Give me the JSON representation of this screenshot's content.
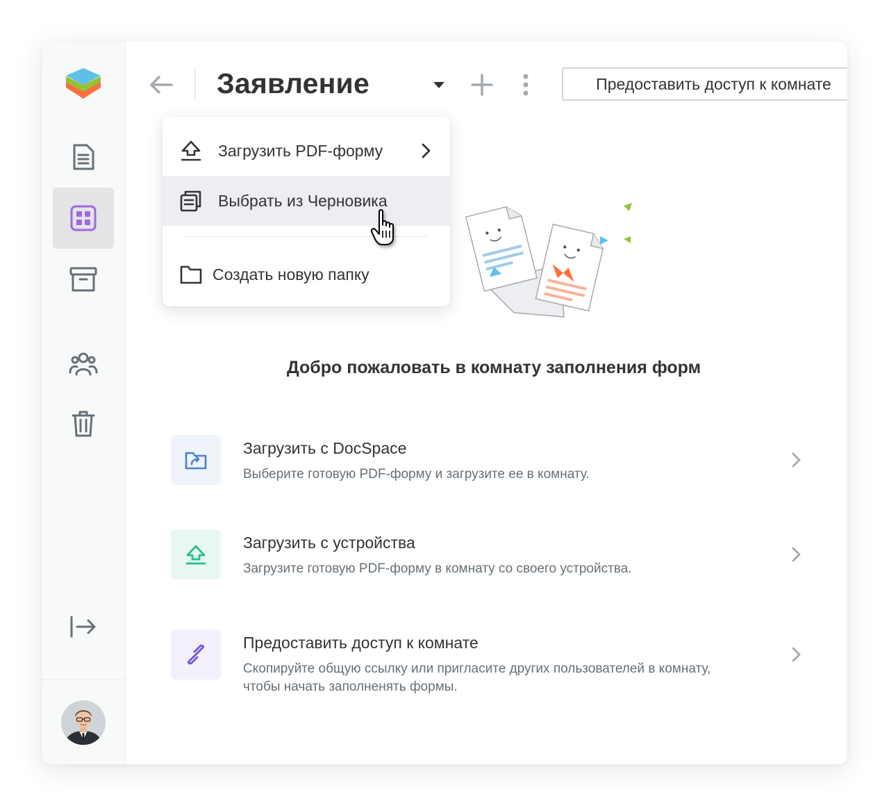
{
  "sidebar": {
    "items": [
      {
        "name": "documents",
        "icon": "document-icon"
      },
      {
        "name": "rooms",
        "icon": "rooms-grid-icon",
        "active": true
      },
      {
        "name": "archive",
        "icon": "archive-icon"
      },
      {
        "name": "accounts",
        "icon": "people-icon"
      },
      {
        "name": "trash",
        "icon": "trash-icon"
      },
      {
        "name": "collapse",
        "icon": "expand-arrow-icon"
      }
    ],
    "accent_color": "#a067e0"
  },
  "header": {
    "title": "Заявление",
    "share_label": "Предоставить доступ к комнате"
  },
  "dropdown": {
    "items": [
      {
        "label": "Загрузить PDF-форму",
        "icon": "upload-icon",
        "has_submenu": true
      },
      {
        "label": "Выбрать из Черновика",
        "icon": "copy-stack-icon",
        "hovered": true
      },
      {
        "label": "Создать новую папку",
        "icon": "folder-icon"
      }
    ]
  },
  "main": {
    "welcome": "Добро пожаловать в комнату заполнения форм",
    "actions": [
      {
        "title": "Загрузить с DocSpace",
        "desc": "Выберите готовую PDF-форму и загрузите ее в комнату.",
        "icon": "docspace-folder-icon",
        "bg": "#eff4fa",
        "color": "#4781d1"
      },
      {
        "title": "Загрузить с устройства",
        "desc": "Загрузите готовую PDF-форму в комнату со своего устройства.",
        "icon": "upload-icon",
        "bg": "#e9f7f3",
        "color": "#22c386"
      },
      {
        "title": "Предоставить доступ к комнате",
        "desc": "Скопируйте общую ссылку или пригласите других пользователей в комнату, чтобы начать заполненять формы.",
        "icon": "link-icon",
        "bg": "#f3f0fb",
        "color": "#7757d9"
      }
    ]
  }
}
